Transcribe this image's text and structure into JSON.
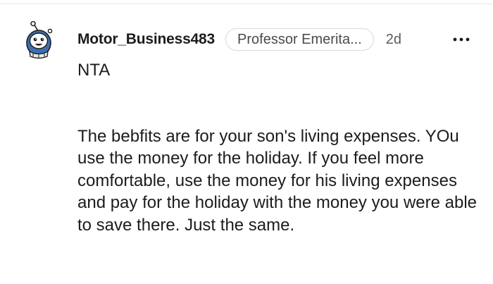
{
  "comment": {
    "author": "Motor_Business483",
    "flair": "Professor Emerita...",
    "timestamp": "2d",
    "more_icon": "more-horizontal-icon",
    "avatar_icon": "snoo-avatar-icon",
    "paragraphs": [
      "NTA",
      "The bebfits are for your son's living expenses. YOu use the money for the holiday. If you feel more comfortable, use the money for his living expenses and pay for the holiday with the money you were able to save there. Just the same."
    ]
  },
  "colors": {
    "text": "#1c1c1c",
    "meta": "#5a5a5a",
    "flair_border": "#d9d9d9",
    "divider": "#e5e5e5"
  }
}
